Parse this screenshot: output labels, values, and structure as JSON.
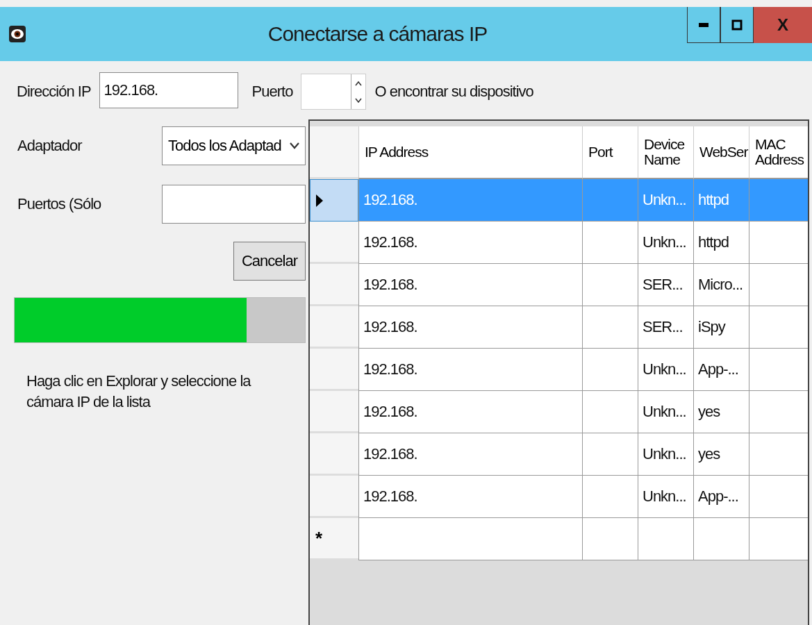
{
  "window": {
    "title": "Conectarse a cámaras IP",
    "close_label": "X"
  },
  "ip_field": {
    "label": "Dirección IP",
    "value": "192.168."
  },
  "port_field": {
    "label": "Puerto"
  },
  "find_label": "O encontrar su dispositivo",
  "adapter": {
    "label": "Adaptador",
    "value": "Todos los Adaptad"
  },
  "ports": {
    "label": "Puertos (Sólo"
  },
  "cancel_button": "Cancelar",
  "progress": {
    "level": 0.8
  },
  "hint": "Haga clic en Explorar y seleccione la cámara IP de la lista",
  "table": {
    "columns": [
      "IP Address",
      "Port",
      "Device Name",
      "WebSer",
      "MAC Address"
    ],
    "rows": [
      {
        "ip": "192.168.",
        "device": "Unkn...",
        "web": "httpd",
        "selected": true
      },
      {
        "ip": "192.168.",
        "device": "Unkn...",
        "web": "httpd",
        "selected": false
      },
      {
        "ip": "192.168.",
        "device": "SER...",
        "web": "Micro...",
        "selected": false
      },
      {
        "ip": "192.168.",
        "device": "SER...",
        "web": "iSpy",
        "selected": false
      },
      {
        "ip": "192.168.",
        "device": "Unkn...",
        "web": "App-...",
        "selected": false
      },
      {
        "ip": "192.168.",
        "device": "Unkn...",
        "web": "yes",
        "selected": false
      },
      {
        "ip": "192.168.",
        "device": "Unkn...",
        "web": "yes",
        "selected": false
      },
      {
        "ip": "192.168.",
        "device": "Unkn...",
        "web": "App-...",
        "selected": false
      }
    ],
    "new_row_marker": "*"
  }
}
